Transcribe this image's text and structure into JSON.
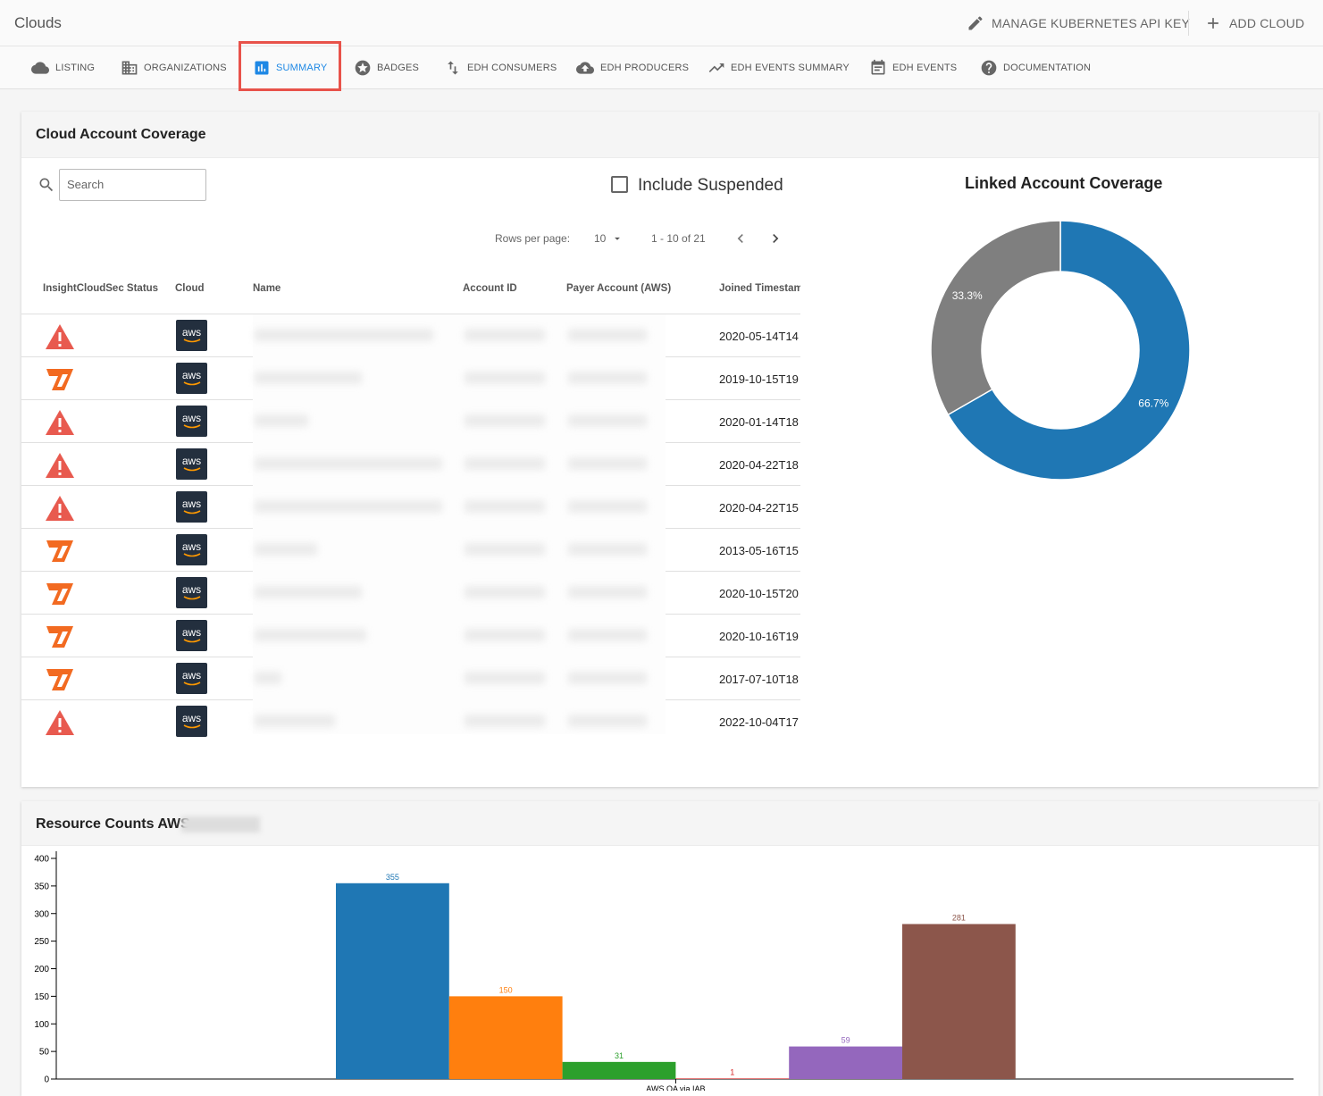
{
  "app": {
    "title": "Clouds"
  },
  "top_actions": {
    "manage_key": "MANAGE KUBERNETES API KEY",
    "add_cloud": "ADD CLOUD"
  },
  "tabs": [
    {
      "label": "LISTING",
      "icon": "cloud-icon"
    },
    {
      "label": "ORGANIZATIONS",
      "icon": "building-icon"
    },
    {
      "label": "SUMMARY",
      "icon": "bar-chart-icon",
      "active": true
    },
    {
      "label": "BADGES",
      "icon": "star-badge-icon"
    },
    {
      "label": "EDH CONSUMERS",
      "icon": "swap-vertical-icon"
    },
    {
      "label": "EDH PRODUCERS",
      "icon": "cloud-upload-icon"
    },
    {
      "label": "EDH EVENTS SUMMARY",
      "icon": "trending-up-icon"
    },
    {
      "label": "EDH EVENTS",
      "icon": "calendar-icon"
    },
    {
      "label": "DOCUMENTATION",
      "icon": "help-icon"
    }
  ],
  "coverage": {
    "title": "Cloud Account Coverage",
    "search_placeholder": "Search",
    "include_suspended": "Include Suspended",
    "rows_per_page_label": "Rows per page:",
    "rows_per_page": "10",
    "page_range": "1 - 10 of 21",
    "columns": [
      "InsightCloudSec Status",
      "Cloud",
      "Name",
      "Account ID",
      "Payer Account (AWS)",
      "Joined Timestam"
    ],
    "rows": [
      {
        "status": "warning",
        "cloud": "aws",
        "joined": "2020-05-14T14"
      },
      {
        "status": "insightcloudsec",
        "cloud": "aws",
        "joined": "2019-10-15T19"
      },
      {
        "status": "warning",
        "cloud": "aws",
        "joined": "2020-01-14T18"
      },
      {
        "status": "warning",
        "cloud": "aws",
        "joined": "2020-04-22T18"
      },
      {
        "status": "warning",
        "cloud": "aws",
        "joined": "2020-04-22T15"
      },
      {
        "status": "insightcloudsec",
        "cloud": "aws",
        "joined": "2013-05-16T15"
      },
      {
        "status": "insightcloudsec",
        "cloud": "aws",
        "joined": "2020-10-15T20"
      },
      {
        "status": "insightcloudsec",
        "cloud": "aws",
        "joined": "2020-10-16T19"
      },
      {
        "status": "insightcloudsec",
        "cloud": "aws",
        "joined": "2017-07-10T18"
      },
      {
        "status": "warning",
        "cloud": "aws",
        "joined": "2022-10-04T17"
      }
    ]
  },
  "resource_counts": {
    "title": "Resource Counts AWS"
  },
  "chart_data": [
    {
      "type": "pie",
      "title": "Linked Account Coverage",
      "donut": true,
      "slices": [
        {
          "value": 66.7,
          "label": "66.7%",
          "color": "#1f77b4"
        },
        {
          "value": 33.3,
          "label": "33.3%",
          "color": "#7f7f7f"
        }
      ]
    },
    {
      "type": "bar",
      "title": "Resource Counts AWS",
      "ylim": [
        0,
        400
      ],
      "yticks": [
        0,
        50,
        100,
        150,
        200,
        250,
        300,
        350,
        400
      ],
      "category": "AWS QA via IAB",
      "values": [
        355,
        150,
        31,
        1,
        59,
        281
      ],
      "colors": [
        "#1f77b4",
        "#ff7f0e",
        "#2ca02c",
        "#d62728",
        "#9467bd",
        "#8c564b"
      ]
    }
  ]
}
